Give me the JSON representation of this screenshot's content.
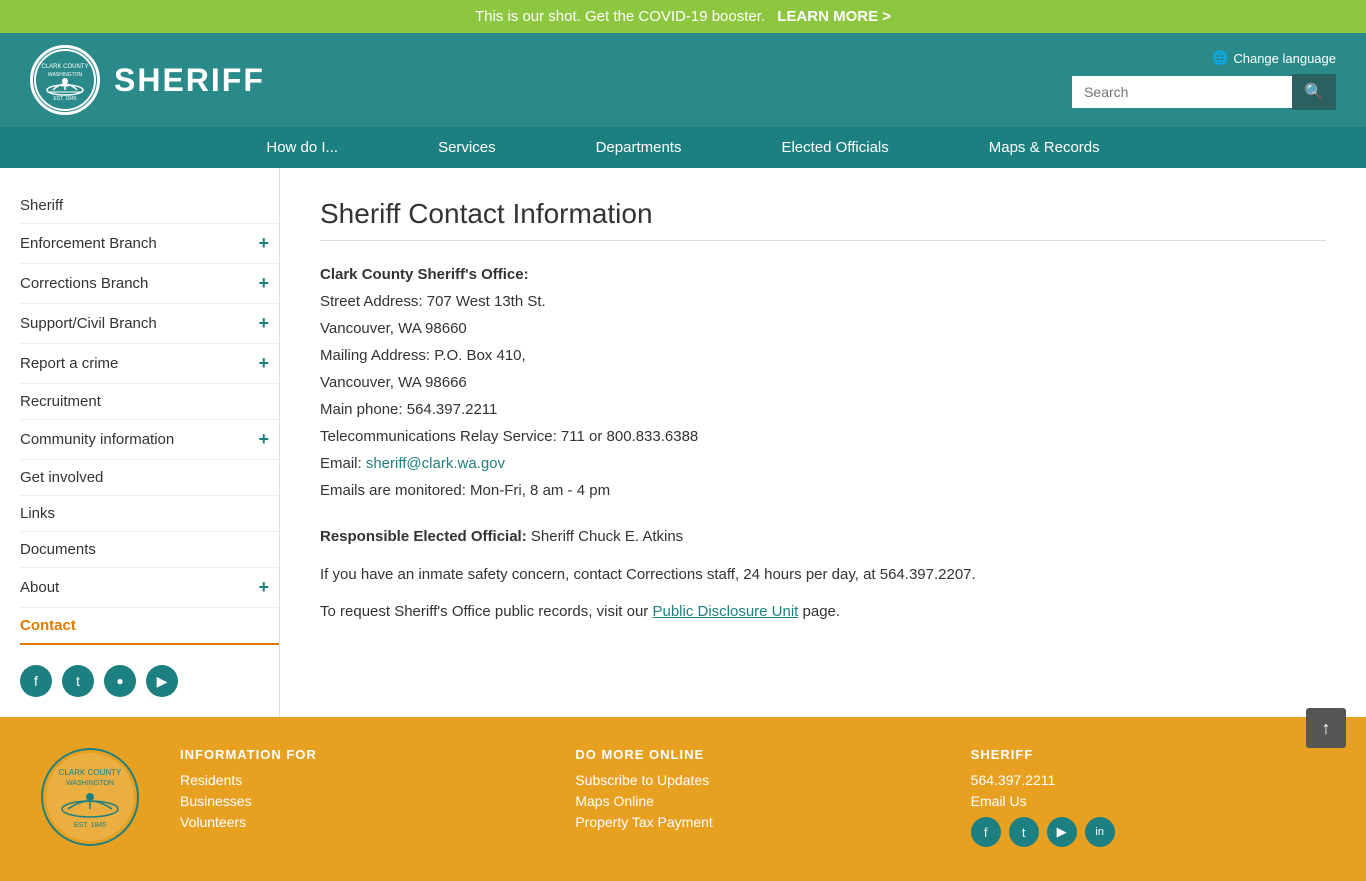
{
  "top_banner": {
    "text": "This is our shot. Get the COVID-19 booster.",
    "link_text": "LEARN MORE >"
  },
  "header": {
    "title": "SHERIFF",
    "change_language": "Change language",
    "search_placeholder": "Search"
  },
  "nav": {
    "items": [
      {
        "label": "How do I...",
        "id": "how-do-i"
      },
      {
        "label": "Services",
        "id": "services"
      },
      {
        "label": "Departments",
        "id": "departments"
      },
      {
        "label": "Elected Officials",
        "id": "elected-officials"
      },
      {
        "label": "Maps & Records",
        "id": "maps-records"
      }
    ]
  },
  "sidebar": {
    "items": [
      {
        "label": "Sheriff",
        "has_toggle": false,
        "active": false,
        "id": "sheriff"
      },
      {
        "label": "Enforcement Branch",
        "has_toggle": true,
        "active": false,
        "id": "enforcement-branch"
      },
      {
        "label": "Corrections Branch",
        "has_toggle": true,
        "active": false,
        "id": "corrections-branch"
      },
      {
        "label": "Support/Civil Branch",
        "has_toggle": true,
        "active": false,
        "id": "support-civil-branch"
      },
      {
        "label": "Report a crime",
        "has_toggle": true,
        "active": false,
        "id": "report-a-crime"
      },
      {
        "label": "Recruitment",
        "has_toggle": false,
        "active": false,
        "id": "recruitment"
      },
      {
        "label": "Community information",
        "has_toggle": true,
        "active": false,
        "id": "community-information"
      },
      {
        "label": "Get involved",
        "has_toggle": false,
        "active": false,
        "id": "get-involved"
      },
      {
        "label": "Links",
        "has_toggle": false,
        "active": false,
        "id": "links"
      },
      {
        "label": "Documents",
        "has_toggle": false,
        "active": false,
        "id": "documents"
      },
      {
        "label": "About",
        "has_toggle": true,
        "active": false,
        "id": "about"
      },
      {
        "label": "Contact",
        "has_toggle": false,
        "active": true,
        "id": "contact"
      }
    ],
    "social": [
      {
        "icon": "f",
        "label": "Facebook",
        "id": "facebook"
      },
      {
        "icon": "t",
        "label": "Twitter",
        "id": "twitter"
      },
      {
        "icon": "in",
        "label": "Instagram",
        "id": "instagram"
      },
      {
        "icon": "▶",
        "label": "YouTube",
        "id": "youtube"
      }
    ]
  },
  "main": {
    "page_title": "Sheriff Contact Information",
    "office_label": "Clark County Sheriff's Office:",
    "street_address": "Street Address: 707 West 13th St.",
    "city_state_zip1": "Vancouver, WA  98660",
    "mailing_address": "Mailing Address: P.O. Box 410,",
    "city_state_zip2": "Vancouver, WA  98666",
    "main_phone": "Main phone: 564.397.2211",
    "trs": "Telecommunications Relay Service: 711 or 800.833.6388",
    "email_label": "Email: ",
    "email_address": "sheriff@clark.wa.gov",
    "email_monitored": "Emails are monitored: Mon-Fri, 8 am - 4 pm",
    "responsible_label": "Responsible Elected Official: ",
    "responsible_name": "Sheriff Chuck E. Atkins",
    "inmate_para": "If you have an inmate safety concern, contact Corrections staff, 24 hours per day, at 564.397.2207.",
    "records_para_before": "To request Sheriff's Office public records, visit our ",
    "records_link_text": "Public Disclosure Unit",
    "records_para_after": " page."
  },
  "footer": {
    "info_for_title": "INFORMATION FOR",
    "info_for_links": [
      {
        "label": "Residents"
      },
      {
        "label": "Businesses"
      },
      {
        "label": "Volunteers"
      }
    ],
    "do_more_title": "DO MORE ONLINE",
    "do_more_links": [
      {
        "label": "Subscribe to Updates"
      },
      {
        "label": "Maps Online"
      },
      {
        "label": "Property Tax Payment"
      }
    ],
    "sheriff_title": "SHERIFF",
    "sheriff_phone": "564.397.2211",
    "sheriff_email_link": "Email Us",
    "sheriff_social": [
      {
        "icon": "f",
        "label": "Facebook"
      },
      {
        "icon": "t",
        "label": "Twitter"
      },
      {
        "icon": "▶",
        "label": "YouTube"
      },
      {
        "icon": "in",
        "label": "LinkedIn"
      }
    ]
  },
  "back_to_top": "↑"
}
